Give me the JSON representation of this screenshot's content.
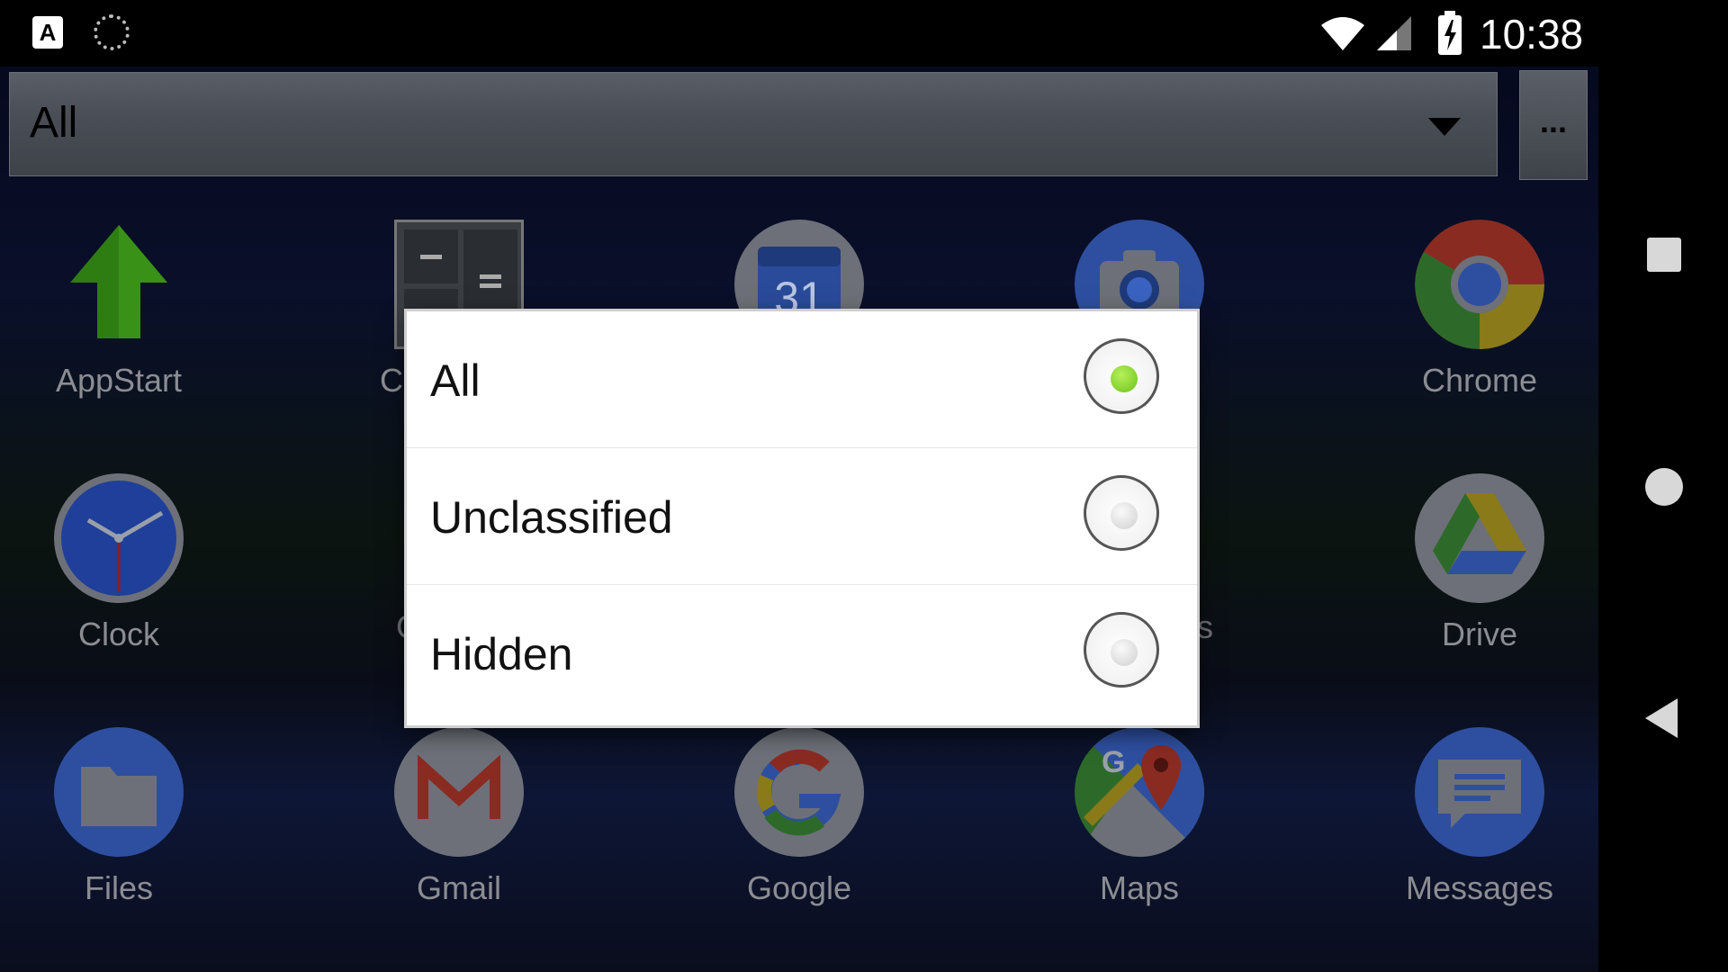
{
  "status_bar": {
    "time": "10:38",
    "icons": [
      "accessibility-a-icon",
      "sync-icon",
      "wifi-icon",
      "signal-icon",
      "battery-charging-icon"
    ]
  },
  "spinner": {
    "selected": "All",
    "more_label": "..."
  },
  "apps": {
    "appstart": "AppStart",
    "calc_partial": "C",
    "chrome": "Chrome",
    "clock": "Clock",
    "clock_right_partial": "C",
    "contacts_partial": "s",
    "drive": "Drive",
    "files": "Files",
    "gmail": "Gmail",
    "google": "Google",
    "maps": "Maps",
    "messages": "Messages"
  },
  "dialog": {
    "options": [
      {
        "label": "All",
        "selected": true
      },
      {
        "label": "Unclassified",
        "selected": false
      },
      {
        "label": "Hidden",
        "selected": false
      }
    ]
  },
  "colors": {
    "radio_selected": "#7ed321",
    "radio_unselected": "#d0d0d0"
  }
}
